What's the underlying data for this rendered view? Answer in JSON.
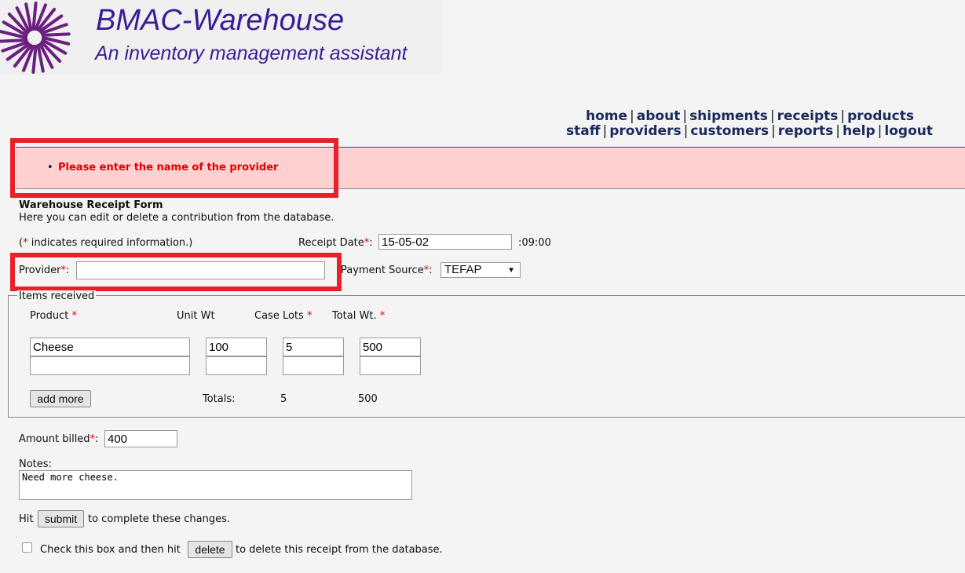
{
  "header": {
    "title": "BMAC-Warehouse",
    "subtitle": "An inventory management assistant",
    "logo": "purple-starburst-logo"
  },
  "nav": {
    "row1": [
      "home",
      "about",
      "shipments",
      "receipts",
      "products"
    ],
    "row2": [
      "staff",
      "providers",
      "customers",
      "reports",
      "help",
      "logout"
    ]
  },
  "error": {
    "message": "Please enter the name of the provider"
  },
  "form": {
    "title": "Warehouse Receipt Form",
    "description": "Here you can edit or delete a contribution from the database.",
    "required_note_prefix": "(",
    "required_star": "*",
    "required_note_suffix": " indicates required information.)",
    "receipt_date_label": "Receipt Date",
    "receipt_date_value": "15-05-02",
    "receipt_time": ":09:00",
    "provider_label": "Provider",
    "provider_value": "",
    "payment_source_label": "Payment Source",
    "payment_source_value": "TEFAP",
    "items_legend": "Items received",
    "columns": {
      "product": "Product",
      "unit_wt": "Unit Wt",
      "case_lots": "Case Lots",
      "total_wt": "Total Wt."
    },
    "items": [
      {
        "product": "Cheese",
        "unit_wt": "100",
        "case_lots": "5",
        "total_wt": "500"
      },
      {
        "product": "",
        "unit_wt": "",
        "case_lots": "",
        "total_wt": ""
      }
    ],
    "add_more_label": "add more",
    "totals_label": "Totals:",
    "total_case_lots": "5",
    "total_weight": "500",
    "amount_billed_label": "Amount billed",
    "amount_billed_value": "400",
    "notes_label": "Notes:",
    "notes_value": "Need more cheese.",
    "hit_label": "Hit",
    "submit_label": "submit",
    "complete_label": "to complete these changes.",
    "check_label": "Check this box and then hit",
    "delete_label": "delete",
    "delete_suffix": "to delete this receipt from the database."
  },
  "colors": {
    "title": "#3a1d96",
    "nav": "#1a2a5a",
    "error_bg": "#ffd0d0",
    "error_text": "#e00000",
    "highlight_box": "#e8202a"
  }
}
